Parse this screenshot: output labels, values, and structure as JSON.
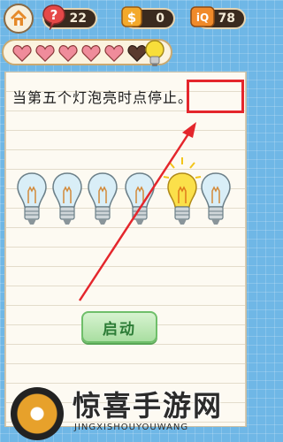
{
  "top_bar": {
    "question_count": "22",
    "coins": "0",
    "score": "78"
  },
  "lives": {
    "full_hearts": 5,
    "empty_hearts": 1
  },
  "puzzle": {
    "question": "当第五个灯泡亮时点停止。",
    "lit_bulb_index": 4,
    "bulb_count": 6,
    "start_label": "启动"
  },
  "watermark": {
    "title": "惊喜手游网",
    "subtitle": "JINGXISHOUYOUWANG"
  },
  "colors": {
    "background": "#6fb7e6",
    "highlight": "#e4262c",
    "button_green": "#a9dea1"
  }
}
